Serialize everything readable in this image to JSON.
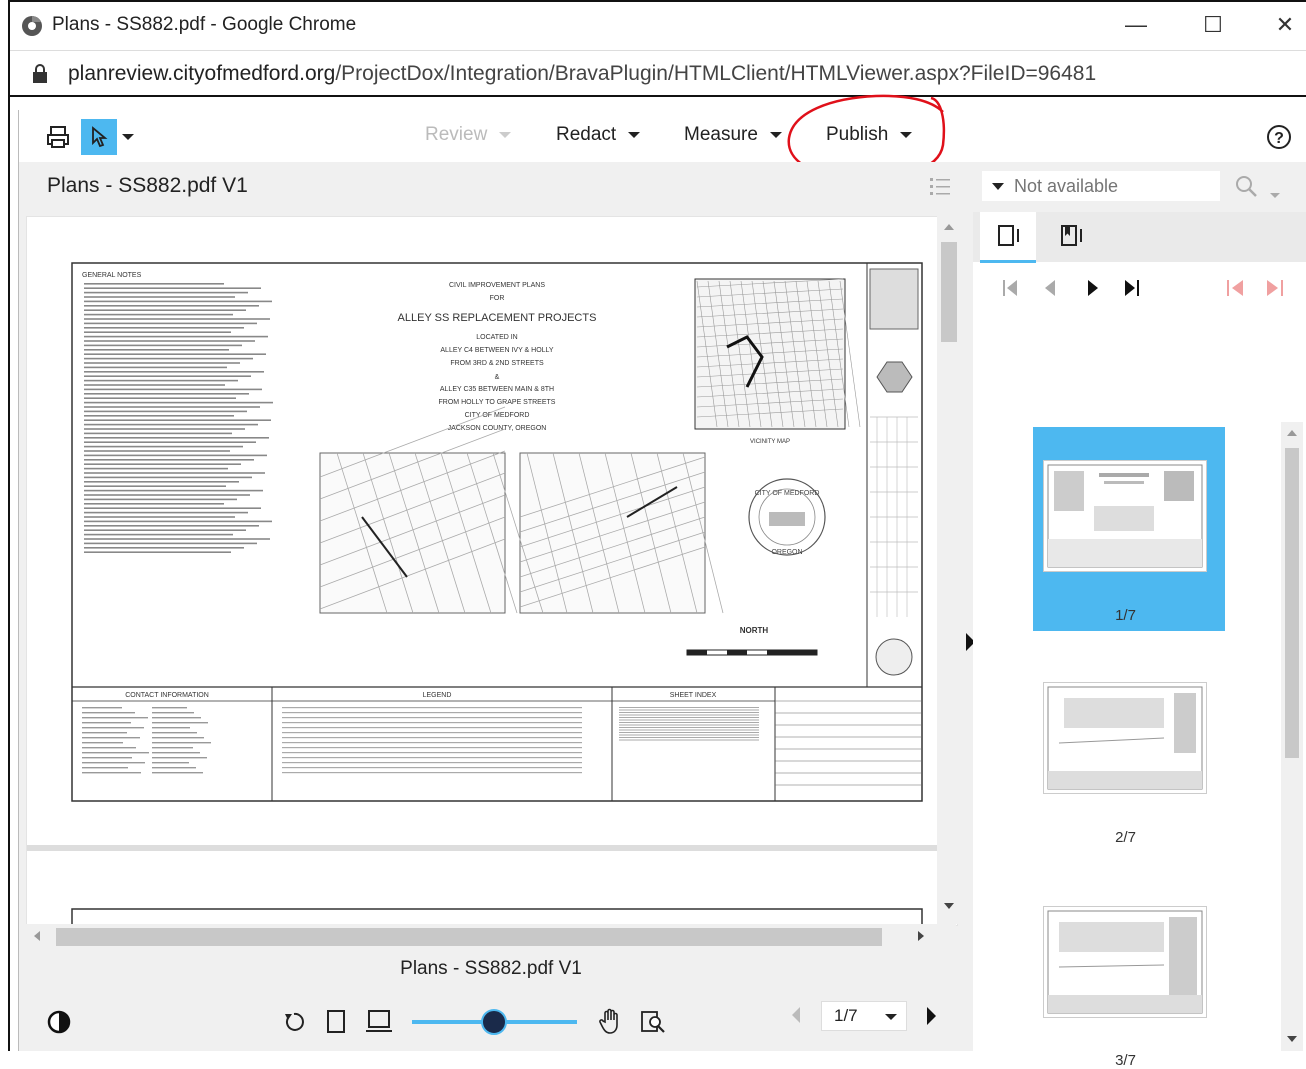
{
  "window": {
    "title": "Plans - SS882.pdf - Google Chrome",
    "url_host": "planreview.cityofmedford.org",
    "url_path": "/ProjectDox/Integration/BravaPlugin/HTMLClient/HTMLViewer.aspx?FileID=96481"
  },
  "toolbar": {
    "menus": [
      "Review",
      "Redact",
      "Measure",
      "Publish"
    ]
  },
  "document": {
    "title": "Plans - SS882.pdf V1",
    "footer_title": "Plans - SS882.pdf V1",
    "page_select": "1/7"
  },
  "search": {
    "placeholder": "Not available"
  },
  "drawing": {
    "notes_heading": "GENERAL NOTES",
    "title_block": [
      "CIVIL IMPROVEMENT PLANS",
      "FOR",
      "ALLEY SS REPLACEMENT PROJECTS",
      "LOCATED IN",
      "ALLEY C4 BETWEEN IVY & HOLLY",
      "FROM 3RD & 2ND STREETS",
      "&",
      "ALLEY C35 BETWEEN MAIN & 8TH",
      "FROM HOLLY TO GRAPE STREETS",
      "CITY OF MEDFORD",
      "JACKSON COUNTY, OREGON"
    ],
    "vicinity_label": "VICINITY MAP",
    "seal_top": "CITY OF MEDFORD",
    "seal_bottom": "OREGON",
    "north_label": "NORTH",
    "contact_heading": "CONTACT INFORMATION",
    "legend_heading": "LEGEND",
    "sheet_index_heading": "SHEET INDEX"
  },
  "thumbnails": [
    {
      "label": "1/7",
      "selected": true
    },
    {
      "label": "2/7",
      "selected": false
    },
    {
      "label": "3/7",
      "selected": false
    }
  ],
  "colors": {
    "accent": "#4db8f0",
    "annotation_circle": "#e0101a",
    "slider": "#4db8f0"
  },
  "icons": [
    "print-icon",
    "select-arrow-icon",
    "help-icon",
    "outline-list-icon",
    "search-icon",
    "single-page-icon",
    "bookmark-page-icon",
    "first-page-icon",
    "prev-page-icon",
    "next-page-icon",
    "last-page-icon",
    "contrast-icon",
    "rotate-icon",
    "fit-page-icon",
    "fit-width-icon",
    "pan-hand-icon",
    "zoom-region-icon"
  ]
}
